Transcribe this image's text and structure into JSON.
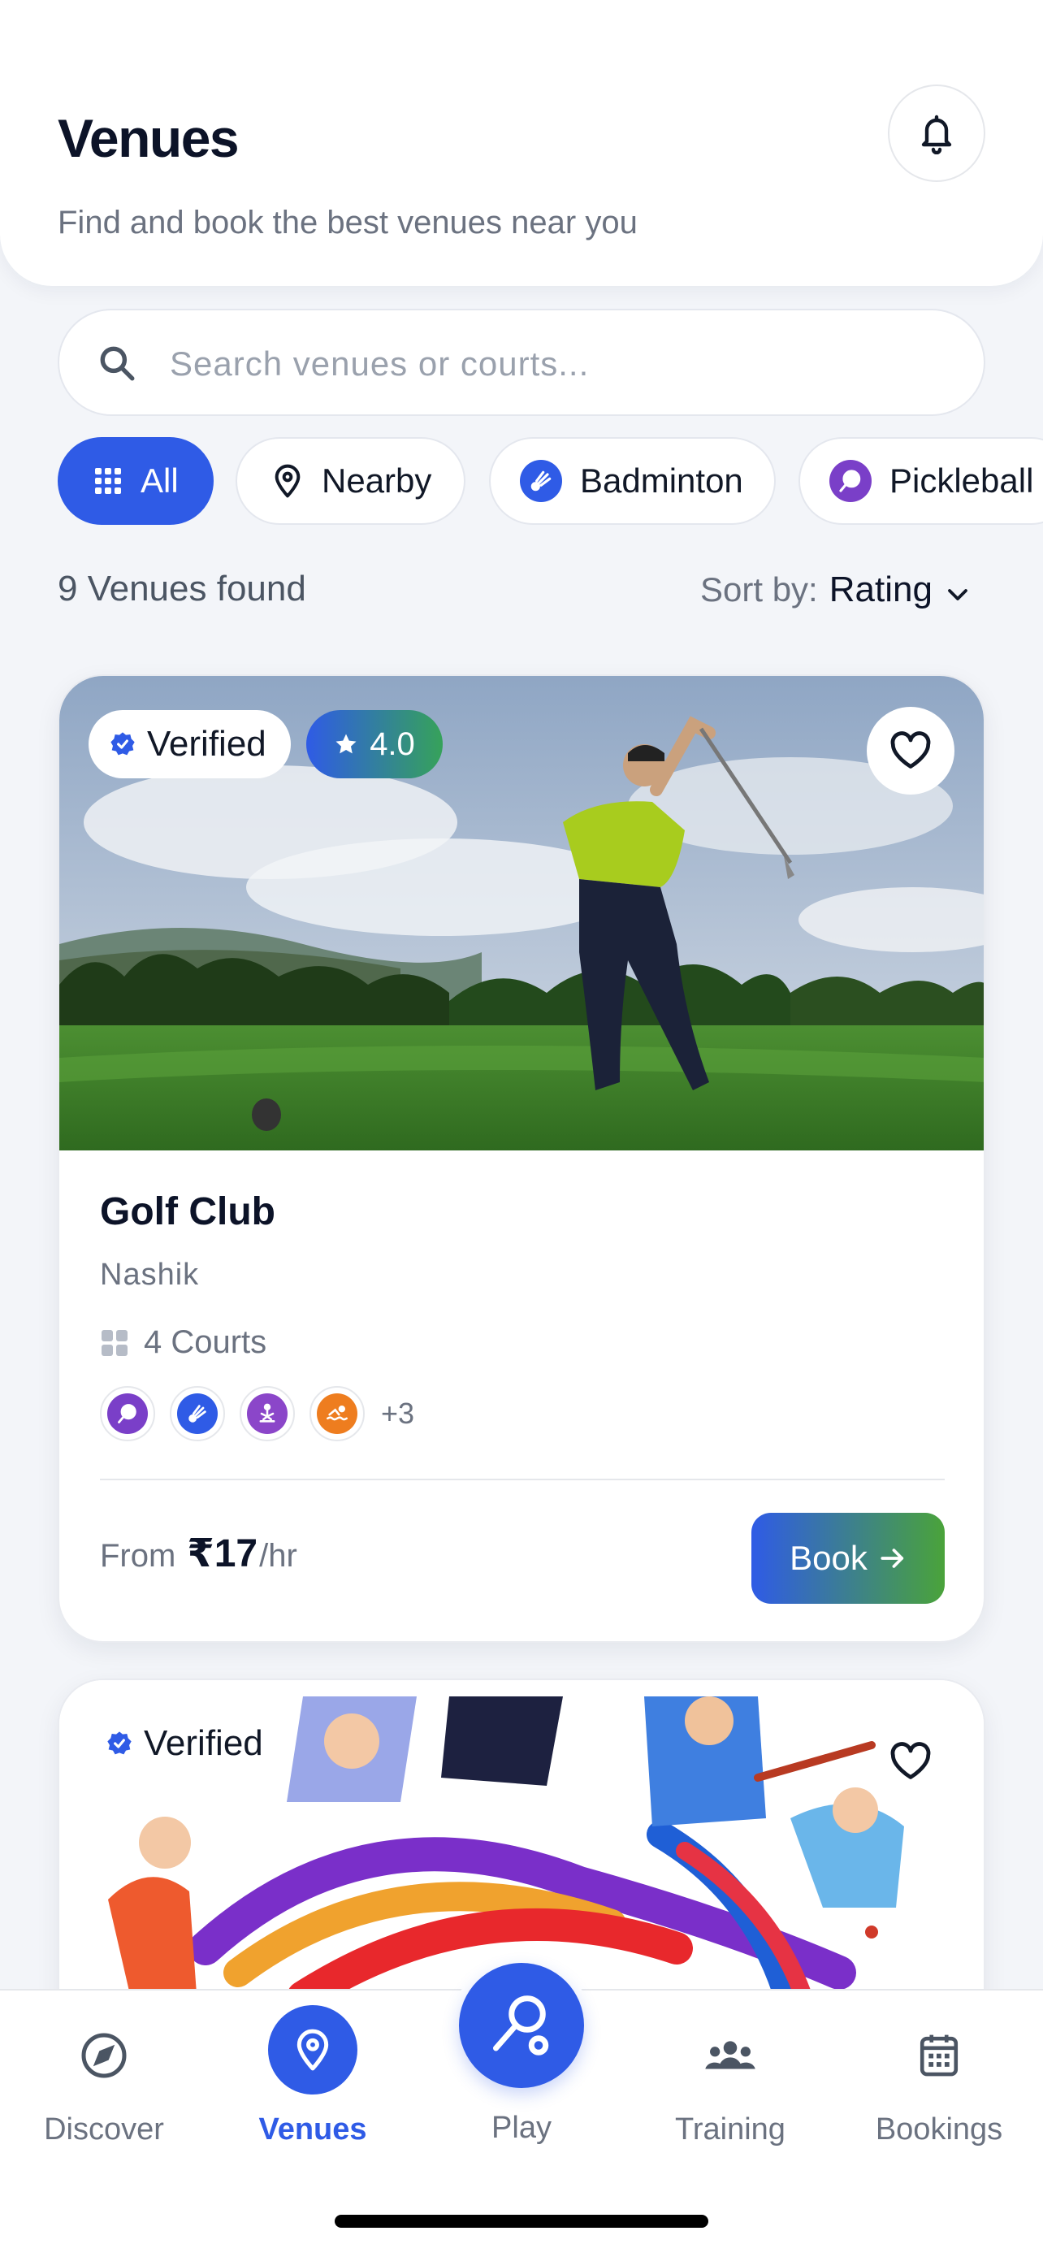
{
  "header": {
    "title": "Venues",
    "subtitle": "Find and book the best venues near you",
    "notification_icon": "bell-icon"
  },
  "search": {
    "placeholder": "Search venues or courts...",
    "value": ""
  },
  "filters": [
    {
      "label": "All",
      "icon": "grid-icon",
      "active": true
    },
    {
      "label": "Nearby",
      "icon": "map-pin-icon",
      "active": false
    },
    {
      "label": "Badminton",
      "icon": "badminton-icon",
      "active": false
    },
    {
      "label": "Pickleball",
      "icon": "pickleball-icon",
      "active": false
    }
  ],
  "results": {
    "count_text": "9 Venues found",
    "sort_label": "Sort by:",
    "sort_value": "Rating"
  },
  "venues": [
    {
      "verified_label": "Verified",
      "rating": "4.0",
      "name": "Golf Club",
      "city": "Nashik",
      "courts": "4 Courts",
      "sports": [
        "pickleball-icon",
        "badminton-icon",
        "yoga-icon",
        "swimming-icon"
      ],
      "more_sports": "+3",
      "price_prefix": "From",
      "price_amount": "₹17",
      "price_unit": "/hr",
      "book_label": "Book"
    },
    {
      "verified_label": "Verified"
    }
  ],
  "nav": {
    "items": [
      {
        "label": "Discover",
        "icon": "compass-icon",
        "active": false
      },
      {
        "label": "Venues",
        "icon": "map-pin-icon",
        "active": true
      },
      {
        "label": "Play",
        "icon": "racket-icon",
        "active": false
      },
      {
        "label": "Training",
        "icon": "group-icon",
        "active": false
      },
      {
        "label": "Bookings",
        "icon": "calendar-icon",
        "active": false
      }
    ]
  },
  "colors": {
    "primary": "#2f5be6",
    "accent_green": "#4aa33a",
    "background": "#f3f5f9",
    "text_dark": "#0c1328",
    "text_muted": "#6b7280"
  }
}
